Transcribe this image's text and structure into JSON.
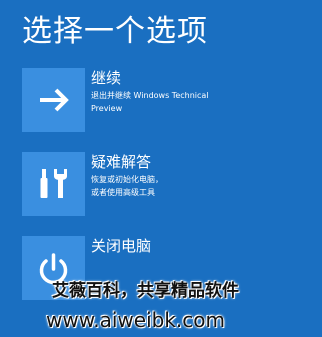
{
  "title": "选择一个选项",
  "options": [
    {
      "icon": "arrow-right-icon",
      "label": "继续",
      "description": [
        "退出并继续 Windows Technical",
        "Preview"
      ]
    },
    {
      "icon": "tools-icon",
      "label": "疑难解答",
      "description": [
        "恢复或初始化电脑，",
        "或者使用高级工具"
      ]
    },
    {
      "icon": "power-icon",
      "label": "关闭电脑",
      "description": []
    }
  ],
  "watermark": {
    "text": "艾薇百科，共享精品软件",
    "url": "www.aiweibk.com"
  },
  "colors": {
    "background": "#1a6fc1",
    "tile": "#3a8fe0",
    "text": "#ffffff"
  }
}
